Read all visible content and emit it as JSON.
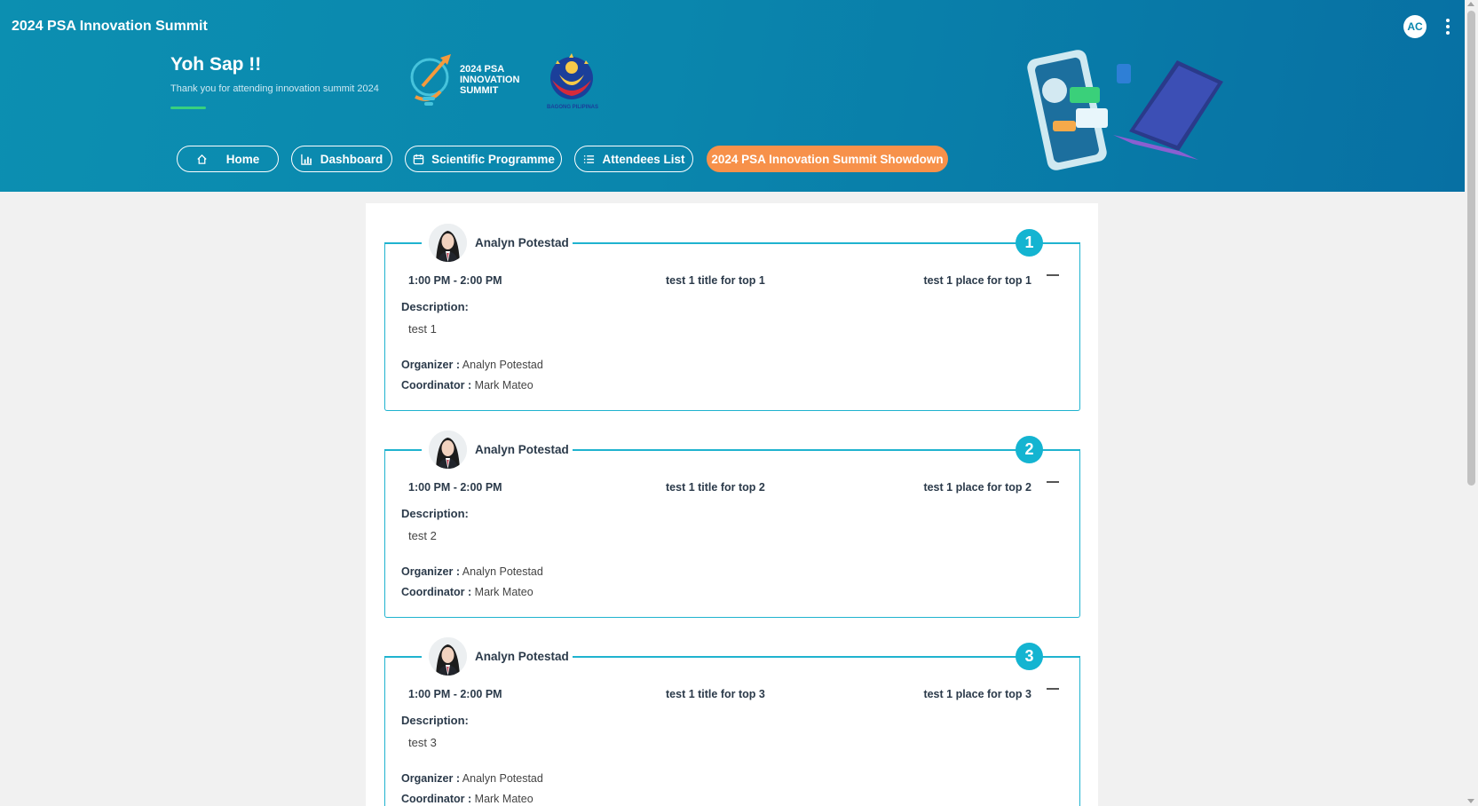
{
  "app": {
    "title": "2024 PSA Innovation Summit"
  },
  "user": {
    "initials": "AC"
  },
  "hero": {
    "greeting": "Yoh Sap !!",
    "subtitle": "Thank you for attending innovation summit 2024",
    "logo_text_line1": "2024 PSA",
    "logo_text_line2": "INNOVATION",
    "logo_text_line3": "SUMMIT",
    "seal_text": "BAGONG PILIPINAS"
  },
  "nav": {
    "home": "Home",
    "dashboard": "Dashboard",
    "scientific": "Scientific Programme",
    "attendees": "Attendees List",
    "showdown": "2024 PSA Innovation Summit Showdown"
  },
  "labels": {
    "description": "Description:",
    "organizer": "Organizer :",
    "coordinator": "Coordinator :"
  },
  "entries": [
    {
      "rank": "1",
      "name": "Analyn Potestad",
      "time": "1:00 PM - 2:00 PM",
      "title": "test 1 title for top 1",
      "place": "test 1 place for top 1",
      "description": "test 1",
      "organizer": "Analyn Potestad",
      "coordinator": "Mark Mateo"
    },
    {
      "rank": "2",
      "name": "Analyn Potestad",
      "time": "1:00 PM - 2:00 PM",
      "title": "test 1 title for top 2",
      "place": "test 1 place for top 2",
      "description": "test 2",
      "organizer": "Analyn Potestad",
      "coordinator": "Mark Mateo"
    },
    {
      "rank": "3",
      "name": "Analyn Potestad",
      "time": "1:00 PM - 2:00 PM",
      "title": "test 1 title for top 3",
      "place": "test 1 place for top 3",
      "description": "test 3",
      "organizer": "Analyn Potestad",
      "coordinator": "Mark Mateo"
    }
  ],
  "colors": {
    "accent": "#14b4d1",
    "active_nav": "#f7914a",
    "header": "#0a86ad"
  }
}
